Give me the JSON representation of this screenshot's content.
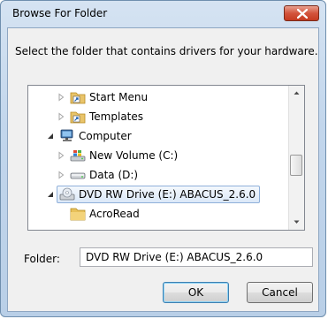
{
  "window": {
    "title": "Browse For Folder",
    "close_icon": "close-icon"
  },
  "prompt": "Select the folder that contains drivers for your hardware.",
  "tree": {
    "items": [
      {
        "label": "Start Menu",
        "icon": "shortcut-folder-icon",
        "expander": "collapsed"
      },
      {
        "label": "Templates",
        "icon": "shortcut-folder-icon",
        "expander": "collapsed"
      },
      {
        "label": "Computer",
        "icon": "computer-icon",
        "expander": "expanded"
      },
      {
        "label": "New Volume (C:)",
        "icon": "windows-drive-icon",
        "expander": "collapsed"
      },
      {
        "label": "Data (D:)",
        "icon": "hard-drive-icon",
        "expander": "collapsed"
      },
      {
        "label": "DVD RW Drive (E:) ABACUS_2.6.0",
        "icon": "dvd-drive-icon",
        "expander": "expanded",
        "selected": true
      },
      {
        "label": "AcroRead",
        "icon": "folder-icon",
        "expander": "none"
      }
    ]
  },
  "folder": {
    "label": "Folder:",
    "value": "DVD RW Drive (E:) ABACUS_2.6.0"
  },
  "buttons": {
    "ok": "OK",
    "cancel": "Cancel"
  }
}
